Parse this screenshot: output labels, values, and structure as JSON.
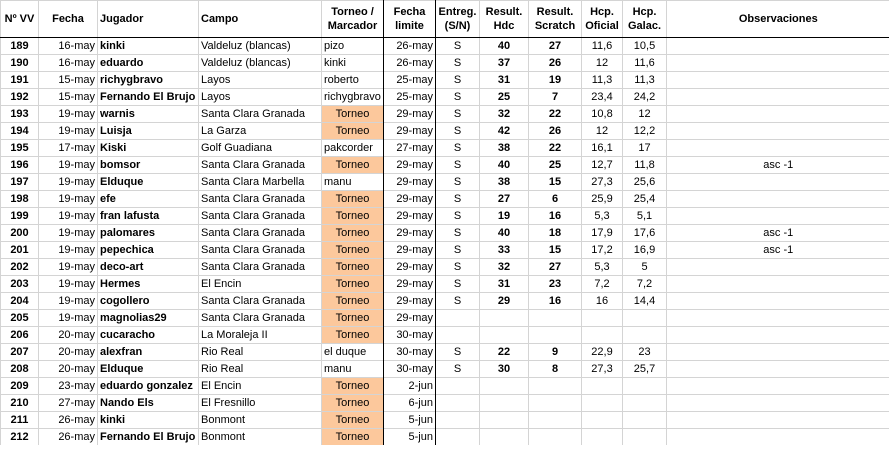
{
  "headers": {
    "num": "Nº VV",
    "fecha": "Fecha",
    "jugador": "Jugador",
    "campo": "Campo",
    "torneo": "Torneo / Marcador",
    "limite": "Fecha limite",
    "entreg": "Entreg. (S/N)",
    "hdc": "Result. Hdc",
    "scratch": "Result. Scratch",
    "oficial": "Hcp. Oficial",
    "galac": "Hcp. Galac.",
    "obs": "Observaciones"
  },
  "rows": [
    {
      "num": "189",
      "fecha": "16-may",
      "jugador": "kinki",
      "campo": "Valdeluz (blancas)",
      "marcador": "pizo",
      "torneo": false,
      "limite": "26-may",
      "entreg": "S",
      "hdc": "40",
      "scratch": "27",
      "oficial": "11,6",
      "galac": "10,5",
      "obs": ""
    },
    {
      "num": "190",
      "fecha": "16-may",
      "jugador": "eduardo",
      "campo": "Valdeluz (blancas)",
      "marcador": "kinki",
      "torneo": false,
      "limite": "26-may",
      "entreg": "S",
      "hdc": "37",
      "scratch": "26",
      "oficial": "12",
      "galac": "11,6",
      "obs": ""
    },
    {
      "num": "191",
      "fecha": "15-may",
      "jugador": "richygbravo",
      "campo": "Layos",
      "marcador": "roberto",
      "torneo": false,
      "limite": "25-may",
      "entreg": "S",
      "hdc": "31",
      "scratch": "19",
      "oficial": "11,3",
      "galac": "11,3",
      "obs": ""
    },
    {
      "num": "192",
      "fecha": "15-may",
      "jugador": "Fernando El Brujo",
      "campo": "Layos",
      "marcador": "richygbravo",
      "torneo": false,
      "limite": "25-may",
      "entreg": "S",
      "hdc": "25",
      "scratch": "7",
      "oficial": "23,4",
      "galac": "24,2",
      "obs": ""
    },
    {
      "num": "193",
      "fecha": "19-may",
      "jugador": "warnis",
      "campo": "Santa Clara Granada",
      "marcador": "Torneo",
      "torneo": true,
      "limite": "29-may",
      "entreg": "S",
      "hdc": "32",
      "scratch": "22",
      "oficial": "10,8",
      "galac": "12",
      "obs": ""
    },
    {
      "num": "194",
      "fecha": "19-may",
      "jugador": "Luisja",
      "campo": "La Garza",
      "marcador": "Torneo",
      "torneo": true,
      "limite": "29-may",
      "entreg": "S",
      "hdc": "42",
      "scratch": "26",
      "oficial": "12",
      "galac": "12,2",
      "obs": ""
    },
    {
      "num": "195",
      "fecha": "17-may",
      "jugador": "Kiski",
      "campo": "Golf Guadiana",
      "marcador": "pakcorder",
      "torneo": false,
      "limite": "27-may",
      "entreg": "S",
      "hdc": "38",
      "scratch": "22",
      "oficial": "16,1",
      "galac": "17",
      "obs": ""
    },
    {
      "num": "196",
      "fecha": "19-may",
      "jugador": "bomsor",
      "campo": "Santa Clara Granada",
      "marcador": "Torneo",
      "torneo": true,
      "limite": "29-may",
      "entreg": "S",
      "hdc": "40",
      "scratch": "25",
      "oficial": "12,7",
      "galac": "11,8",
      "obs": "asc -1"
    },
    {
      "num": "197",
      "fecha": "19-may",
      "jugador": "Elduque",
      "campo": "Santa Clara Marbella",
      "marcador": "manu",
      "torneo": false,
      "limite": "29-may",
      "entreg": "S",
      "hdc": "38",
      "scratch": "15",
      "oficial": "27,3",
      "galac": "25,6",
      "obs": ""
    },
    {
      "num": "198",
      "fecha": "19-may",
      "jugador": "efe",
      "campo": "Santa Clara Granada",
      "marcador": "Torneo",
      "torneo": true,
      "limite": "29-may",
      "entreg": "S",
      "hdc": "27",
      "scratch": "6",
      "oficial": "25,9",
      "galac": "25,4",
      "obs": ""
    },
    {
      "num": "199",
      "fecha": "19-may",
      "jugador": "fran lafusta",
      "campo": "Santa Clara Granada",
      "marcador": "Torneo",
      "torneo": true,
      "limite": "29-may",
      "entreg": "S",
      "hdc": "19",
      "scratch": "16",
      "oficial": "5,3",
      "galac": "5,1",
      "obs": ""
    },
    {
      "num": "200",
      "fecha": "19-may",
      "jugador": "palomares",
      "campo": "Santa Clara Granada",
      "marcador": "Torneo",
      "torneo": true,
      "limite": "29-may",
      "entreg": "S",
      "hdc": "40",
      "scratch": "18",
      "oficial": "17,9",
      "galac": "17,6",
      "obs": "asc -1"
    },
    {
      "num": "201",
      "fecha": "19-may",
      "jugador": "pepechica",
      "campo": "Santa Clara Granada",
      "marcador": "Torneo",
      "torneo": true,
      "limite": "29-may",
      "entreg": "S",
      "hdc": "33",
      "scratch": "15",
      "oficial": "17,2",
      "galac": "16,9",
      "obs": "asc -1"
    },
    {
      "num": "202",
      "fecha": "19-may",
      "jugador": "deco-art",
      "campo": "Santa Clara Granada",
      "marcador": "Torneo",
      "torneo": true,
      "limite": "29-may",
      "entreg": "S",
      "hdc": "32",
      "scratch": "27",
      "oficial": "5,3",
      "galac": "5",
      "obs": ""
    },
    {
      "num": "203",
      "fecha": "19-may",
      "jugador": "Hermes",
      "campo": "El Encin",
      "marcador": "Torneo",
      "torneo": true,
      "limite": "29-may",
      "entreg": "S",
      "hdc": "31",
      "scratch": "23",
      "oficial": "7,2",
      "galac": "7,2",
      "obs": ""
    },
    {
      "num": "204",
      "fecha": "19-may",
      "jugador": "cogollero",
      "campo": "Santa Clara Granada",
      "marcador": "Torneo",
      "torneo": true,
      "limite": "29-may",
      "entreg": "S",
      "hdc": "29",
      "scratch": "16",
      "oficial": "16",
      "galac": "14,4",
      "obs": ""
    },
    {
      "num": "205",
      "fecha": "19-may",
      "jugador": "magnolias29",
      "campo": "Santa Clara Granada",
      "marcador": "Torneo",
      "torneo": true,
      "limite": "29-may",
      "entreg": "",
      "hdc": "",
      "scratch": "",
      "oficial": "",
      "galac": "",
      "obs": ""
    },
    {
      "num": "206",
      "fecha": "20-may",
      "jugador": "cucaracho",
      "campo": "La Moraleja II",
      "marcador": "Torneo",
      "torneo": true,
      "limite": "30-may",
      "entreg": "",
      "hdc": "",
      "scratch": "",
      "oficial": "",
      "galac": "",
      "obs": ""
    },
    {
      "num": "207",
      "fecha": "20-may",
      "jugador": "alexfran",
      "campo": "Rio Real",
      "marcador": "el duque",
      "torneo": false,
      "limite": "30-may",
      "entreg": "S",
      "hdc": "22",
      "scratch": "9",
      "oficial": "22,9",
      "galac": "23",
      "obs": ""
    },
    {
      "num": "208",
      "fecha": "20-may",
      "jugador": "Elduque",
      "campo": "Rio Real",
      "marcador": "manu",
      "torneo": false,
      "limite": "30-may",
      "entreg": "S",
      "hdc": "30",
      "scratch": "8",
      "oficial": "27,3",
      "galac": "25,7",
      "obs": ""
    },
    {
      "num": "209",
      "fecha": "23-may",
      "jugador": "eduardo gonzalez",
      "campo": "El Encin",
      "marcador": "Torneo",
      "torneo": true,
      "limite": "2-jun",
      "entreg": "",
      "hdc": "",
      "scratch": "",
      "oficial": "",
      "galac": "",
      "obs": ""
    },
    {
      "num": "210",
      "fecha": "27-may",
      "jugador": "Nando Els",
      "campo": "El Fresnillo",
      "marcador": "Torneo",
      "torneo": true,
      "limite": "6-jun",
      "entreg": "",
      "hdc": "",
      "scratch": "",
      "oficial": "",
      "galac": "",
      "obs": ""
    },
    {
      "num": "211",
      "fecha": "26-may",
      "jugador": "kinki",
      "campo": "Bonmont",
      "marcador": "Torneo",
      "torneo": true,
      "limite": "5-jun",
      "entreg": "",
      "hdc": "",
      "scratch": "",
      "oficial": "",
      "galac": "",
      "obs": ""
    },
    {
      "num": "212",
      "fecha": "26-may",
      "jugador": "Fernando El Brujo",
      "campo": "Bonmont",
      "marcador": "Torneo",
      "torneo": true,
      "limite": "5-jun",
      "entreg": "",
      "hdc": "",
      "scratch": "",
      "oficial": "",
      "galac": "",
      "obs": ""
    }
  ]
}
